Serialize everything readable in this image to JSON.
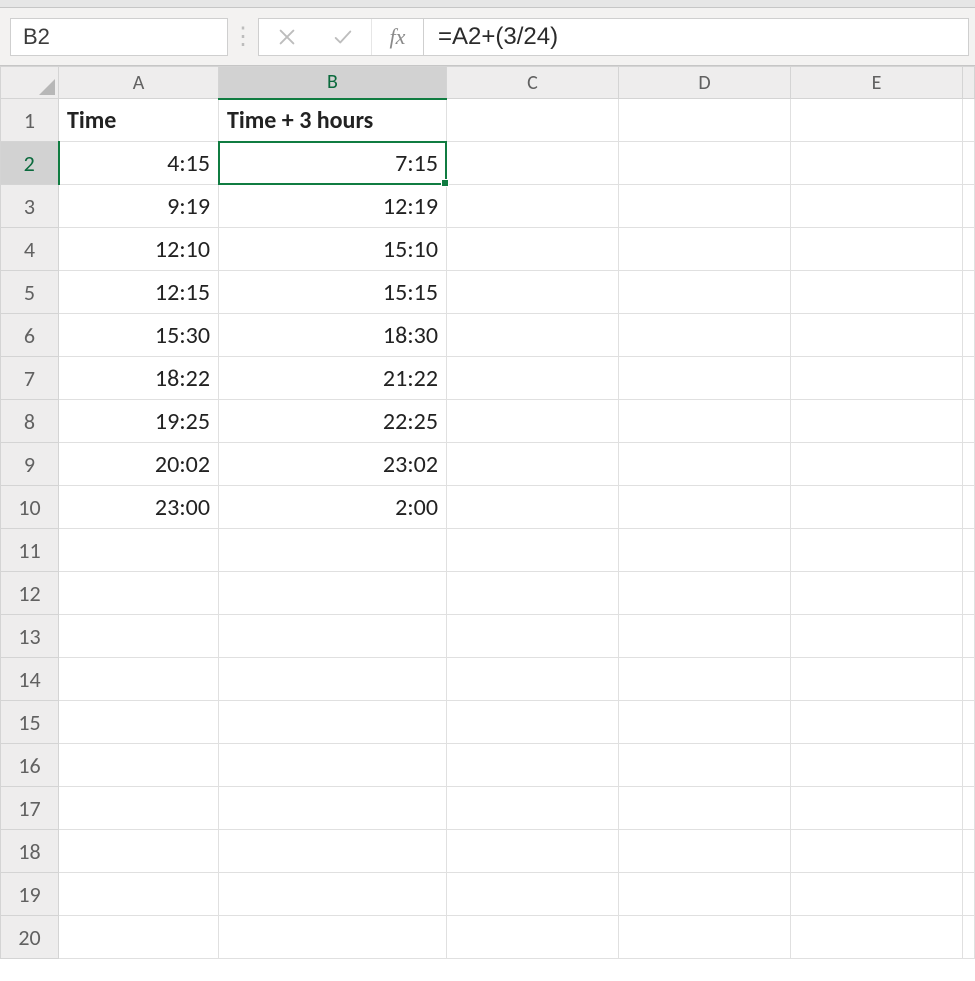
{
  "formulaBar": {
    "nameBox": "B2",
    "formula": "=A2+(3/24)",
    "fxLabel": "fx"
  },
  "columns": [
    "A",
    "B",
    "C",
    "D",
    "E"
  ],
  "visibleRows": 20,
  "activeCell": {
    "col": 1,
    "row": 1
  },
  "rows": [
    {
      "num": "1",
      "cells": [
        {
          "v": "Time",
          "h": true,
          "align": "left"
        },
        {
          "v": "Time + 3 hours",
          "h": true,
          "align": "left"
        },
        {
          "v": ""
        },
        {
          "v": ""
        },
        {
          "v": ""
        }
      ]
    },
    {
      "num": "2",
      "cells": [
        {
          "v": "4:15"
        },
        {
          "v": "7:15"
        },
        {
          "v": ""
        },
        {
          "v": ""
        },
        {
          "v": ""
        }
      ]
    },
    {
      "num": "3",
      "cells": [
        {
          "v": "9:19"
        },
        {
          "v": "12:19"
        },
        {
          "v": ""
        },
        {
          "v": ""
        },
        {
          "v": ""
        }
      ]
    },
    {
      "num": "4",
      "cells": [
        {
          "v": "12:10"
        },
        {
          "v": "15:10"
        },
        {
          "v": ""
        },
        {
          "v": ""
        },
        {
          "v": ""
        }
      ]
    },
    {
      "num": "5",
      "cells": [
        {
          "v": "12:15"
        },
        {
          "v": "15:15"
        },
        {
          "v": ""
        },
        {
          "v": ""
        },
        {
          "v": ""
        }
      ]
    },
    {
      "num": "6",
      "cells": [
        {
          "v": "15:30"
        },
        {
          "v": "18:30"
        },
        {
          "v": ""
        },
        {
          "v": ""
        },
        {
          "v": ""
        }
      ]
    },
    {
      "num": "7",
      "cells": [
        {
          "v": "18:22"
        },
        {
          "v": "21:22"
        },
        {
          "v": ""
        },
        {
          "v": ""
        },
        {
          "v": ""
        }
      ]
    },
    {
      "num": "8",
      "cells": [
        {
          "v": "19:25"
        },
        {
          "v": "22:25"
        },
        {
          "v": ""
        },
        {
          "v": ""
        },
        {
          "v": ""
        }
      ]
    },
    {
      "num": "9",
      "cells": [
        {
          "v": "20:02"
        },
        {
          "v": "23:02"
        },
        {
          "v": ""
        },
        {
          "v": ""
        },
        {
          "v": ""
        }
      ]
    },
    {
      "num": "10",
      "cells": [
        {
          "v": "23:00"
        },
        {
          "v": "2:00"
        },
        {
          "v": ""
        },
        {
          "v": ""
        },
        {
          "v": ""
        }
      ]
    },
    {
      "num": "11",
      "cells": [
        {
          "v": ""
        },
        {
          "v": ""
        },
        {
          "v": ""
        },
        {
          "v": ""
        },
        {
          "v": ""
        }
      ]
    },
    {
      "num": "12",
      "cells": [
        {
          "v": ""
        },
        {
          "v": ""
        },
        {
          "v": ""
        },
        {
          "v": ""
        },
        {
          "v": ""
        }
      ]
    },
    {
      "num": "13",
      "cells": [
        {
          "v": ""
        },
        {
          "v": ""
        },
        {
          "v": ""
        },
        {
          "v": ""
        },
        {
          "v": ""
        }
      ]
    },
    {
      "num": "14",
      "cells": [
        {
          "v": ""
        },
        {
          "v": ""
        },
        {
          "v": ""
        },
        {
          "v": ""
        },
        {
          "v": ""
        }
      ]
    },
    {
      "num": "15",
      "cells": [
        {
          "v": ""
        },
        {
          "v": ""
        },
        {
          "v": ""
        },
        {
          "v": ""
        },
        {
          "v": ""
        }
      ]
    },
    {
      "num": "16",
      "cells": [
        {
          "v": ""
        },
        {
          "v": ""
        },
        {
          "v": ""
        },
        {
          "v": ""
        },
        {
          "v": ""
        }
      ]
    },
    {
      "num": "17",
      "cells": [
        {
          "v": ""
        },
        {
          "v": ""
        },
        {
          "v": ""
        },
        {
          "v": ""
        },
        {
          "v": ""
        }
      ]
    },
    {
      "num": "18",
      "cells": [
        {
          "v": ""
        },
        {
          "v": ""
        },
        {
          "v": ""
        },
        {
          "v": ""
        },
        {
          "v": ""
        }
      ]
    },
    {
      "num": "19",
      "cells": [
        {
          "v": ""
        },
        {
          "v": ""
        },
        {
          "v": ""
        },
        {
          "v": ""
        },
        {
          "v": ""
        }
      ]
    },
    {
      "num": "20",
      "cells": [
        {
          "v": ""
        },
        {
          "v": ""
        },
        {
          "v": ""
        },
        {
          "v": ""
        },
        {
          "v": ""
        }
      ]
    }
  ]
}
